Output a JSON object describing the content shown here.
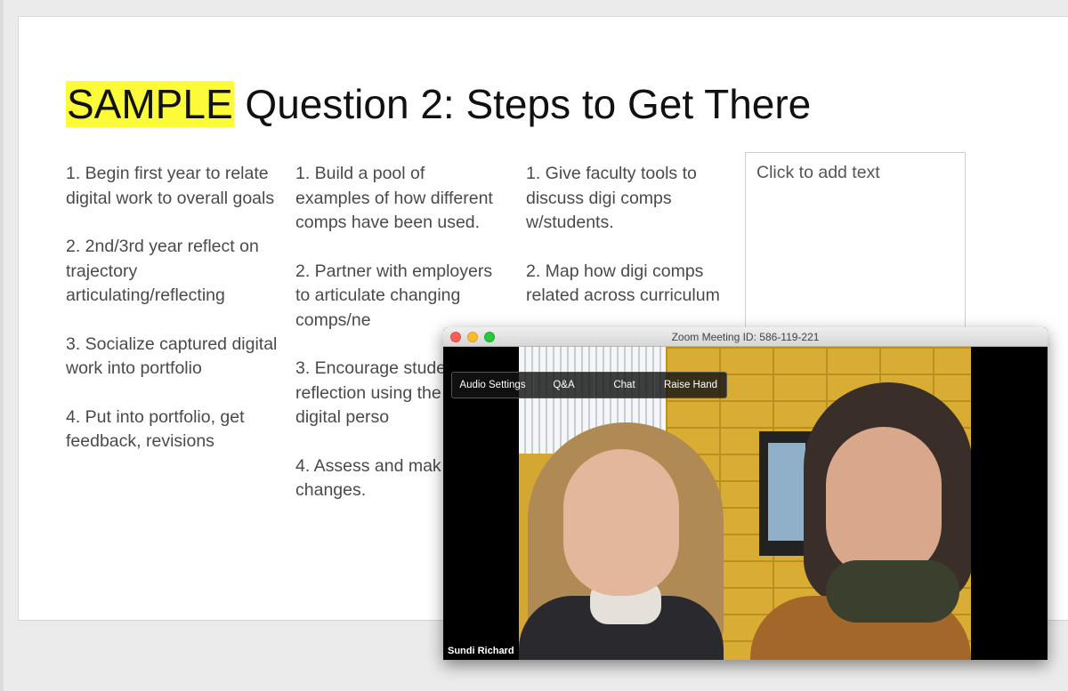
{
  "slide": {
    "title_highlight": "SAMPLE",
    "title_rest": " Question 2: Steps to Get There",
    "columns": [
      [
        "1. Begin first year to relate digital work to overall goals",
        "2. 2nd/3rd year reflect on trajectory articulating/reflecting",
        "3. Socialize captured digital work into portfolio",
        "4. Put into portfolio, get feedback, revisions"
      ],
      [
        "1. Build a pool of examples of how different comps have been used.",
        "2. Partner with employers to articulate changing comps/ne",
        "3. Encourage stude reflection using the public digital perso",
        "4. Assess and mak changes."
      ],
      [
        "1. Give faculty tools to discuss digi comps w/students.",
        "2. Map how digi comps related across curriculum"
      ]
    ],
    "placeholder": "Click to add text",
    "highlight_color": "#fbfb3a"
  },
  "zoom": {
    "window_title": "Zoom Meeting ID: 586-119-221",
    "toolbar": [
      "Audio Settings",
      "Q&A",
      "Chat",
      "Raise Hand"
    ],
    "participant_name": "Sundi Richard"
  }
}
